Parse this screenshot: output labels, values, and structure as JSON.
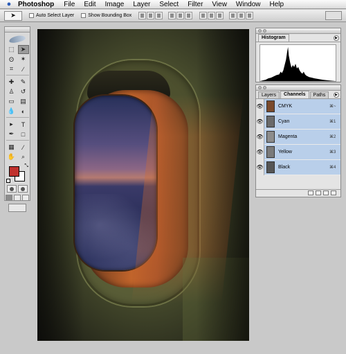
{
  "menubar": {
    "app_name": "Photoshop",
    "items": [
      "File",
      "Edit",
      "Image",
      "Layer",
      "Select",
      "Filter",
      "View",
      "Window",
      "Help"
    ]
  },
  "options": {
    "auto_select_label": "Auto Select Layer",
    "auto_select_checked": false,
    "bounding_box_label": "Show Bounding Box",
    "bounding_box_checked": false
  },
  "toolbox": {
    "active_tool": "move-tool",
    "foreground_color": "#c0322e",
    "background_color": "#ffffff"
  },
  "histogram_panel": {
    "tabs": [
      "Histogram"
    ],
    "active_tab": "Histogram"
  },
  "channels_panel": {
    "tabs": [
      "Layers",
      "Channels",
      "Paths"
    ],
    "active_tab": "Channels",
    "channels": [
      {
        "name": "CMYK",
        "shortcut": "⌘~",
        "thumb": "#7a4a2c"
      },
      {
        "name": "Cyan",
        "shortcut": "⌘1",
        "thumb": "#6a6a6a"
      },
      {
        "name": "Magenta",
        "shortcut": "⌘2",
        "thumb": "#8c8c8c"
      },
      {
        "name": "Yellow",
        "shortcut": "⌘3",
        "thumb": "#7a7a7a"
      },
      {
        "name": "Black",
        "shortcut": "⌘4",
        "thumb": "#555555"
      }
    ]
  },
  "colors": {
    "channel_selection": "#b9cfea",
    "canvas_wall": "#4d5230"
  }
}
